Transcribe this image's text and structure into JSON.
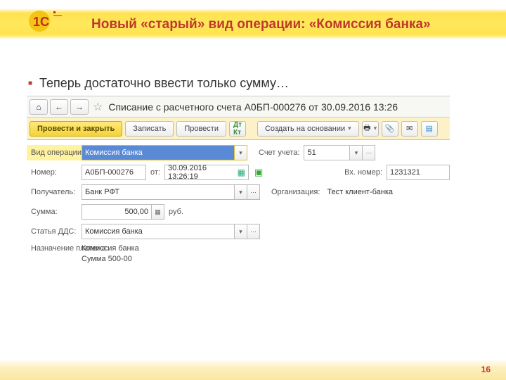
{
  "slide": {
    "title": "Новый «старый» вид операции: «Комиссия банка»",
    "bullet": "Теперь достаточно ввести только сумму…",
    "page_number": "16"
  },
  "app": {
    "doc_title": "Списание с расчетного счета А0БП-000276 от 30.09.2016 13:26",
    "toolbar": {
      "submit_close": "Провести и закрыть",
      "save": "Записать",
      "submit": "Провести",
      "create_based": "Создать на основании"
    },
    "form": {
      "op_type_label": "Вид операции:",
      "op_type_value": "Комиссия банка",
      "account_label": "Счет учета:",
      "account_value": "51",
      "number_label": "Номер:",
      "number_value": "А0БП-000276",
      "from_label": "от:",
      "date_value": "30.09.2016 13:26:19",
      "inc_number_label": "Вх. номер:",
      "inc_number_value": "1231321",
      "recipient_label": "Получатель:",
      "recipient_value": "Банк РФТ",
      "org_label": "Организация:",
      "org_value": "Тест клиент-банка",
      "sum_label": "Сумма:",
      "sum_value": "500,00",
      "currency": "руб.",
      "dds_label": "Статья ДДС:",
      "dds_value": "Комиссия банка",
      "purpose_label": "Назначение платежа:",
      "purpose_line1": "Комиссия банка",
      "purpose_line2": "Сумма 500-00"
    }
  }
}
